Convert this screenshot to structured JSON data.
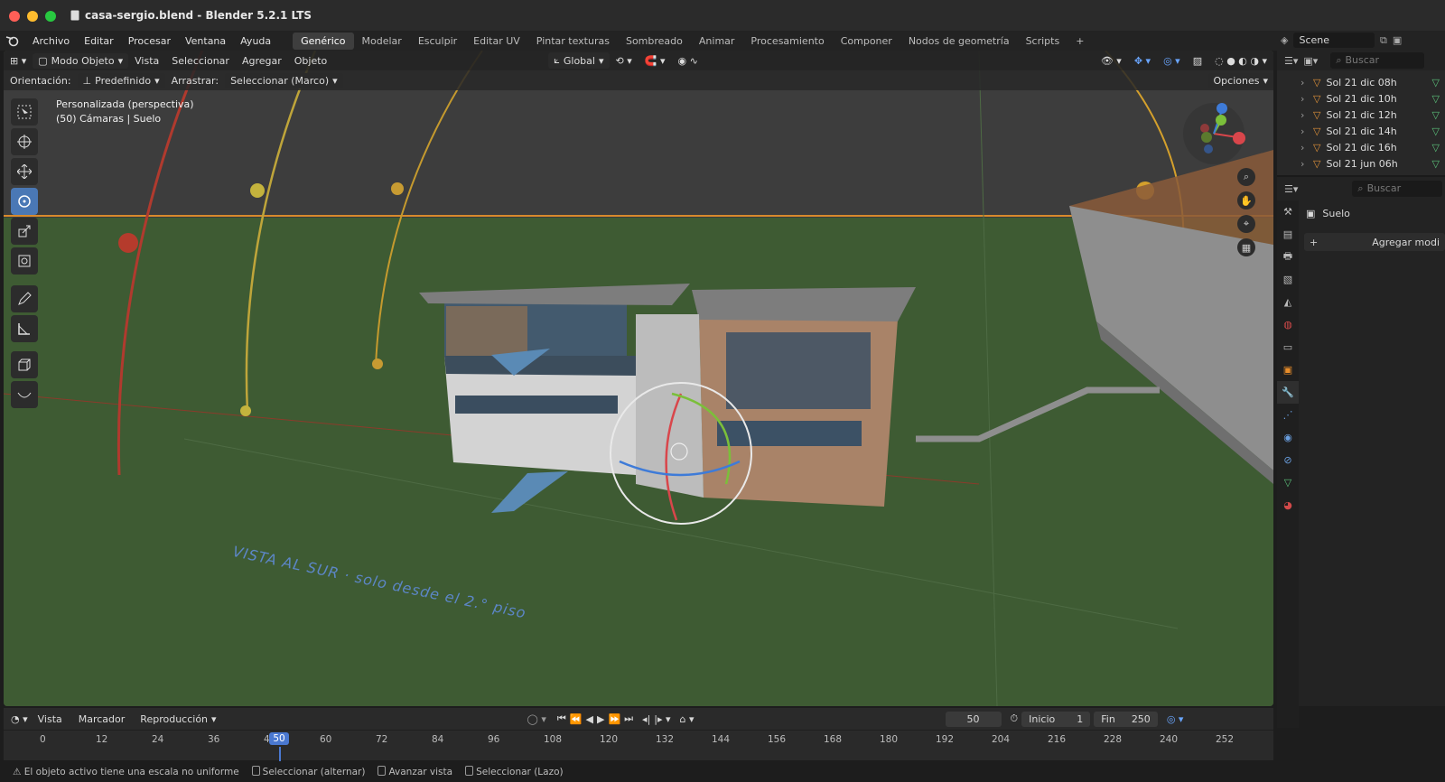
{
  "window": {
    "title": "casa-sergio.blend - Blender 5.2.1 LTS"
  },
  "menu": [
    "Archivo",
    "Editar",
    "Procesar",
    "Ventana",
    "Ayuda"
  ],
  "workspaces": [
    "Genérico",
    "Modelar",
    "Esculpir",
    "Editar UV",
    "Pintar texturas",
    "Sombreado",
    "Animar",
    "Procesamiento",
    "Componer",
    "Nodos de geometría",
    "Scripts"
  ],
  "workspace_add": "+",
  "scene": {
    "label": "Scene"
  },
  "viewport": {
    "mode": "Modo Objeto",
    "menus": [
      "Vista",
      "Seleccionar",
      "Agregar",
      "Objeto"
    ],
    "transform": "Global",
    "orientation_label": "Orientación:",
    "orientation_value": "Predefinido",
    "drag_label": "Arrastrar:",
    "drag_value": "Seleccionar (Marco)",
    "options": "Opciones",
    "info_line1": "Personalizada (perspectiva)",
    "info_line2": "(50) Cámaras | Suelo",
    "ground_text": "VISTA AL SUR · solo desde el 2.° piso",
    "axes": {
      "x": "X",
      "y": "Y",
      "z": "Z"
    }
  },
  "outliner": {
    "search_placeholder": "Buscar",
    "items": [
      "Sol 21 dic 08h",
      "Sol 21 dic 10h",
      "Sol 21 dic 12h",
      "Sol 21 dic 14h",
      "Sol 21 dic 16h",
      "Sol 21 jun 06h"
    ]
  },
  "properties": {
    "search_placeholder": "Buscar",
    "object_name": "Suelo",
    "add_modifier": "Agregar modi"
  },
  "timeline": {
    "menus": [
      "Vista",
      "Marcador",
      "Reproducción"
    ],
    "current_frame": "50",
    "start_label": "Inicio",
    "start_value": "1",
    "end_label": "Fin",
    "end_value": "250",
    "ruler": [
      "0",
      "12",
      "24",
      "36",
      "48",
      "60",
      "72",
      "84",
      "96",
      "108",
      "120",
      "132",
      "144",
      "156",
      "168",
      "180",
      "192",
      "204",
      "216",
      "228",
      "240",
      "252"
    ],
    "playhead_label": "50"
  },
  "status": {
    "warning": "El objeto activo tiene una escala no uniforme",
    "hint1": "Seleccionar (alternar)",
    "hint2": "Avanzar vista",
    "hint3": "Seleccionar (Lazo)"
  }
}
